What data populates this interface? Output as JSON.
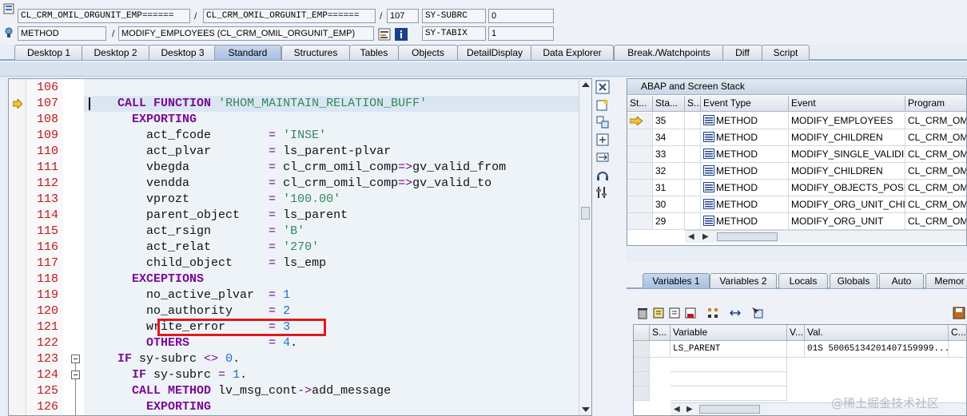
{
  "header": {
    "row1": {
      "class_field": "CL_CRM_OMIL_ORGUNIT_EMP======",
      "include_field": "CL_CRM_OMIL_ORGUNIT_EMP======",
      "separator1": "/",
      "separator2": "/",
      "line_field": "107",
      "sysvar_name": "SY-SUBRC",
      "sysvar_value": "0"
    },
    "row2": {
      "type_field": "METHOD",
      "separator": "/",
      "method_field": "MODIFY_EMPLOYEES (CL_CRM_OMIL_ORGUNIT_EMP)",
      "sysvar_name": "SY-TABIX",
      "sysvar_value": "1"
    }
  },
  "tabs": [
    {
      "label": "Desktop 1"
    },
    {
      "label": "Desktop 2"
    },
    {
      "label": "Desktop 3"
    },
    {
      "label": "Standard"
    },
    {
      "label": "Structures"
    },
    {
      "label": "Tables"
    },
    {
      "label": "Objects"
    },
    {
      "label": "DetailDisplay"
    },
    {
      "label": "Data Explorer"
    },
    {
      "label": "Break./Watchpoints"
    },
    {
      "label": "Diff"
    },
    {
      "label": "Script"
    }
  ],
  "active_tab": "Standard",
  "code": {
    "lines": [
      {
        "num": "106",
        "text": ""
      },
      {
        "num": "107",
        "text": "    CALL FUNCTION 'RHOM_MAINTAIN_RELATION_BUFF'"
      },
      {
        "num": "108",
        "text": "      EXPORTING"
      },
      {
        "num": "109",
        "text": "        act_fcode        = 'INSE'"
      },
      {
        "num": "110",
        "text": "        act_plvar        = ls_parent-plvar"
      },
      {
        "num": "111",
        "text": "        vbegda           = cl_crm_omil_comp=>gv_valid_from"
      },
      {
        "num": "112",
        "text": "        vendda           = cl_crm_omil_comp=>gv_valid_to"
      },
      {
        "num": "113",
        "text": "        vprozt           = '100.00'"
      },
      {
        "num": "114",
        "text": "        parent_object    = ls_parent"
      },
      {
        "num": "115",
        "text": "        act_rsign        = 'B'"
      },
      {
        "num": "116",
        "text": "        act_relat        = '270'"
      },
      {
        "num": "117",
        "text": "        child_object     = ls_emp"
      },
      {
        "num": "118",
        "text": "      EXCEPTIONS"
      },
      {
        "num": "119",
        "text": "        no_active_plvar  = 1"
      },
      {
        "num": "120",
        "text": "        no_authority     = 2"
      },
      {
        "num": "121",
        "text": "        write_error      = 3"
      },
      {
        "num": "122",
        "text": "        OTHERS           = 4."
      },
      {
        "num": "123",
        "text": "    IF sy-subrc <> 0."
      },
      {
        "num": "124",
        "text": "      IF sy-subrc = 1."
      },
      {
        "num": "125",
        "text": "      CALL METHOD lv_msg_cont->add_message"
      },
      {
        "num": "126",
        "text": "        EXPORTING"
      }
    ]
  },
  "stack": {
    "title": "ABAP and Screen Stack",
    "columns": [
      "St...",
      "Sta...",
      "S...",
      "Event Type",
      "Event",
      "Program"
    ],
    "rows": [
      {
        "level": "35",
        "type": "METHOD",
        "event": "MODIFY_EMPLOYEES",
        "program": "CL_CRM_OMIL"
      },
      {
        "level": "34",
        "type": "METHOD",
        "event": "MODIFY_CHILDREN",
        "program": "CL_CRM_OMIL"
      },
      {
        "level": "33",
        "type": "METHOD",
        "event": "MODIFY_SINGLE_VALIDI...",
        "program": "CL_CRM_OMIL"
      },
      {
        "level": "32",
        "type": "METHOD",
        "event": "MODIFY_CHILDREN",
        "program": "CL_CRM_OMIL"
      },
      {
        "level": "31",
        "type": "METHOD",
        "event": "MODIFY_OBJECTS_POSI...",
        "program": "CL_CRM_OMIL"
      },
      {
        "level": "30",
        "type": "METHOD",
        "event": "MODIFY_ORG_UNIT_CHI...",
        "program": "CL_CRM_OMIL"
      },
      {
        "level": "29",
        "type": "METHOD",
        "event": "MODIFY_ORG_UNIT",
        "program": "CL_CRM_OMIL"
      }
    ]
  },
  "variables": {
    "tabs": [
      {
        "label": "Variables 1"
      },
      {
        "label": "Variables 2"
      },
      {
        "label": "Locals"
      },
      {
        "label": "Globals"
      },
      {
        "label": "Auto"
      },
      {
        "label": "Memor"
      }
    ],
    "columns": [
      "S...",
      "Variable",
      "V...",
      "Val.",
      "C..."
    ],
    "rows": [
      {
        "variable": "LS_PARENT",
        "value": "01S  50065134201407159999..."
      }
    ]
  },
  "watermark": "@稀土掘金技术社区",
  "colors": {
    "line_number": "#c4161c",
    "keyword": "#7a0a93",
    "string": "#2e8b57",
    "number": "#1e70c9",
    "highlight_box": "#e0191c",
    "active_tab": "#a7bfe0"
  }
}
